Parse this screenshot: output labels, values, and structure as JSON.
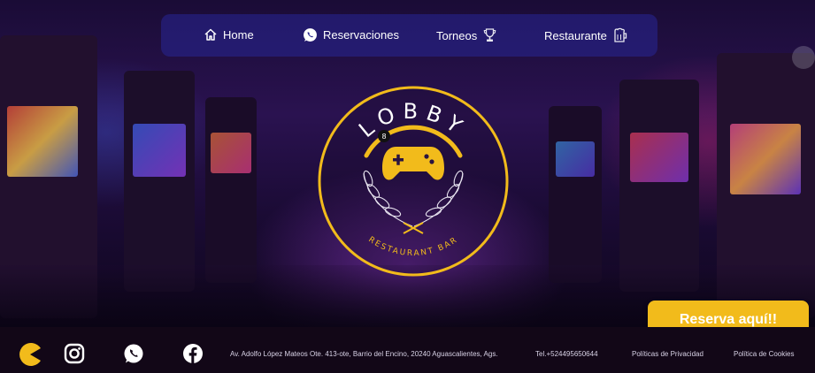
{
  "nav": {
    "items": [
      {
        "label": "Home",
        "icon": "home-icon"
      },
      {
        "label": "Reservaciones",
        "icon": "whatsapp-icon"
      },
      {
        "label": "Torneos",
        "icon": "trophy-icon"
      },
      {
        "label": "Restaurante",
        "icon": "beer-mug-icon"
      }
    ]
  },
  "logo": {
    "title": "LOBBY",
    "subtitle": "RESTAURANT BAR",
    "accent": "#f2bb1b"
  },
  "cta": {
    "label": "Reserva aquí!!"
  },
  "footer": {
    "social_icons": [
      "pacman-icon",
      "instagram-icon",
      "whatsapp-icon",
      "facebook-icon"
    ],
    "address": "Av. Adolfo López Mateos Ote. 413-ote, Barrio del Encino, 20240 Aguascalientes, Ags.",
    "phone": "Tel.+524495650644",
    "privacy": "Políticas de Privacidad",
    "cookies": "Política de Cookies"
  },
  "colors": {
    "accent": "#f2bb1b",
    "navbar": "#28268f",
    "footer_bg": "#120717"
  }
}
